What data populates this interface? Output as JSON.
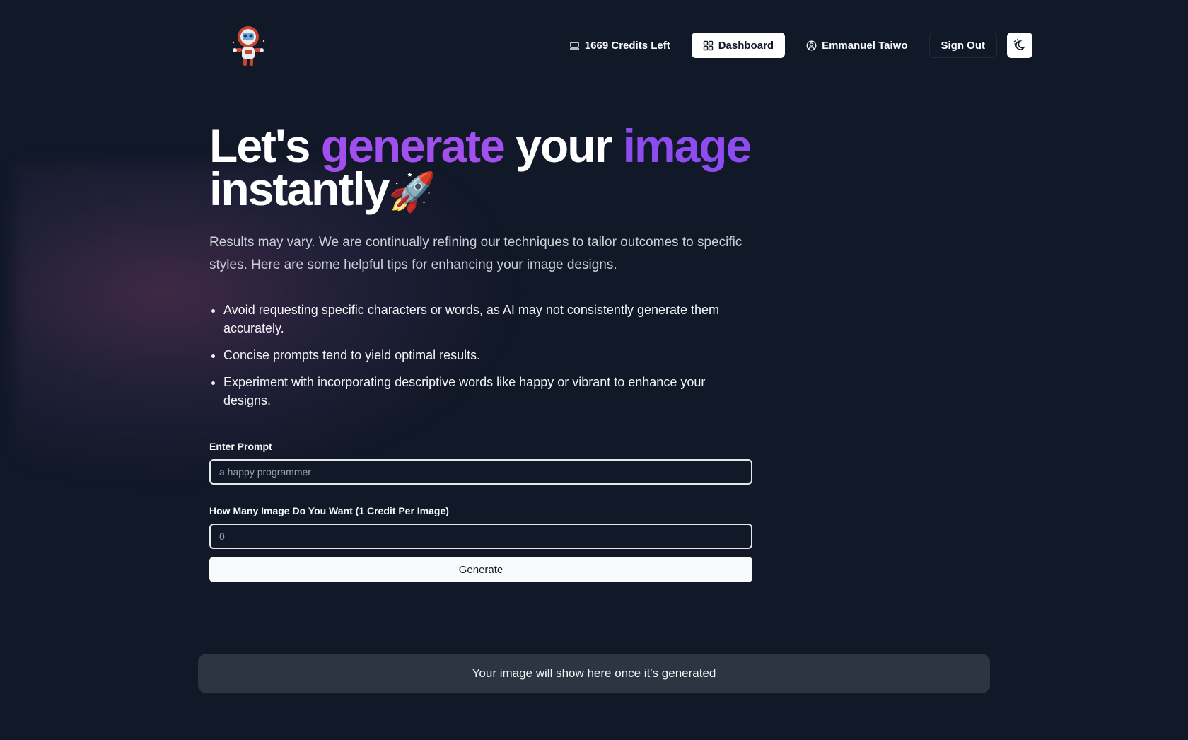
{
  "header": {
    "logo_icon": "robot-astronaut-logo",
    "credits_label": "1669 Credits Left",
    "dashboard_label": "Dashboard",
    "user_name": "Emmanuel Taiwo",
    "signout_label": "Sign Out",
    "theme_icon": "theme-toggle-icon"
  },
  "hero": {
    "title_part1": "Let's ",
    "title_accent1": "generate",
    "title_part2": " your ",
    "title_accent2": "image",
    "title_part3": "instantly",
    "title_emoji": "🚀",
    "intro": "Results may vary. We are continually refining our techniques to tailor outcomes to specific styles. Here are some helpful tips for enhancing your image designs."
  },
  "tips": [
    "Avoid requesting specific characters or words, as AI may not consistently generate them accurately.",
    "Concise prompts tend to yield optimal results.",
    "Experiment with incorporating descriptive words like happy or vibrant to enhance your designs."
  ],
  "form": {
    "prompt_label": "Enter Prompt",
    "prompt_placeholder": "a happy programmer",
    "prompt_value": "",
    "count_label": "How Many Image Do You Want (1 Credit Per Image)",
    "count_placeholder": "0",
    "count_value": "",
    "generate_label": "Generate"
  },
  "result": {
    "placeholder_text": "Your image will show here once it's generated"
  },
  "colors": {
    "background": "#111827",
    "accent_purple": "#a24ff0",
    "accent_violet": "#8e4cf0"
  }
}
